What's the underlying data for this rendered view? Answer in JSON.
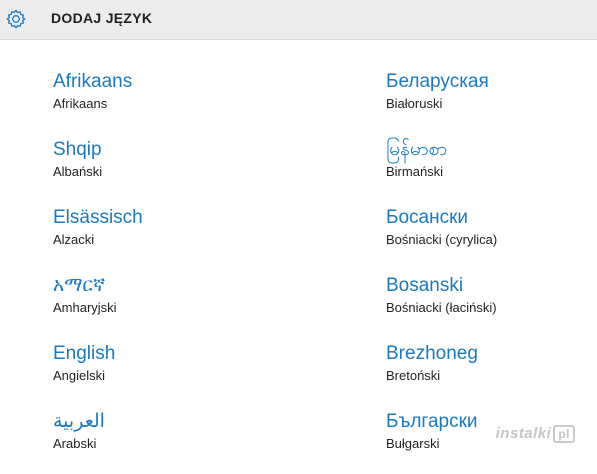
{
  "header": {
    "title": "DODAJ JĘZYK",
    "icon": "gear-icon"
  },
  "colors": {
    "accent": "#1b78c2",
    "header_bg": "#ececec"
  },
  "languages": [
    {
      "native": "Afrikaans",
      "polish": "Afrikaans"
    },
    {
      "native": "Shqip",
      "polish": "Albański"
    },
    {
      "native": "Elsässisch",
      "polish": "Alzacki"
    },
    {
      "native": "አማርኛ",
      "polish": "Amharyjski"
    },
    {
      "native": "English",
      "polish": "Angielski"
    },
    {
      "native": "العربية",
      "polish": "Arabski"
    },
    {
      "native": "Беларуская",
      "polish": "Białoruski"
    },
    {
      "native": "မြန်မာစာ",
      "polish": "Birmański"
    },
    {
      "native": "Босански",
      "polish": "Bośniacki (cyrylica)"
    },
    {
      "native": "Bosanski",
      "polish": "Bośniacki (łaciński)"
    },
    {
      "native": "Brezhoneg",
      "polish": "Bretoński"
    },
    {
      "native": "Български",
      "polish": "Bułgarski"
    }
  ],
  "watermark": {
    "text": "instalki",
    "badge": "pl"
  }
}
